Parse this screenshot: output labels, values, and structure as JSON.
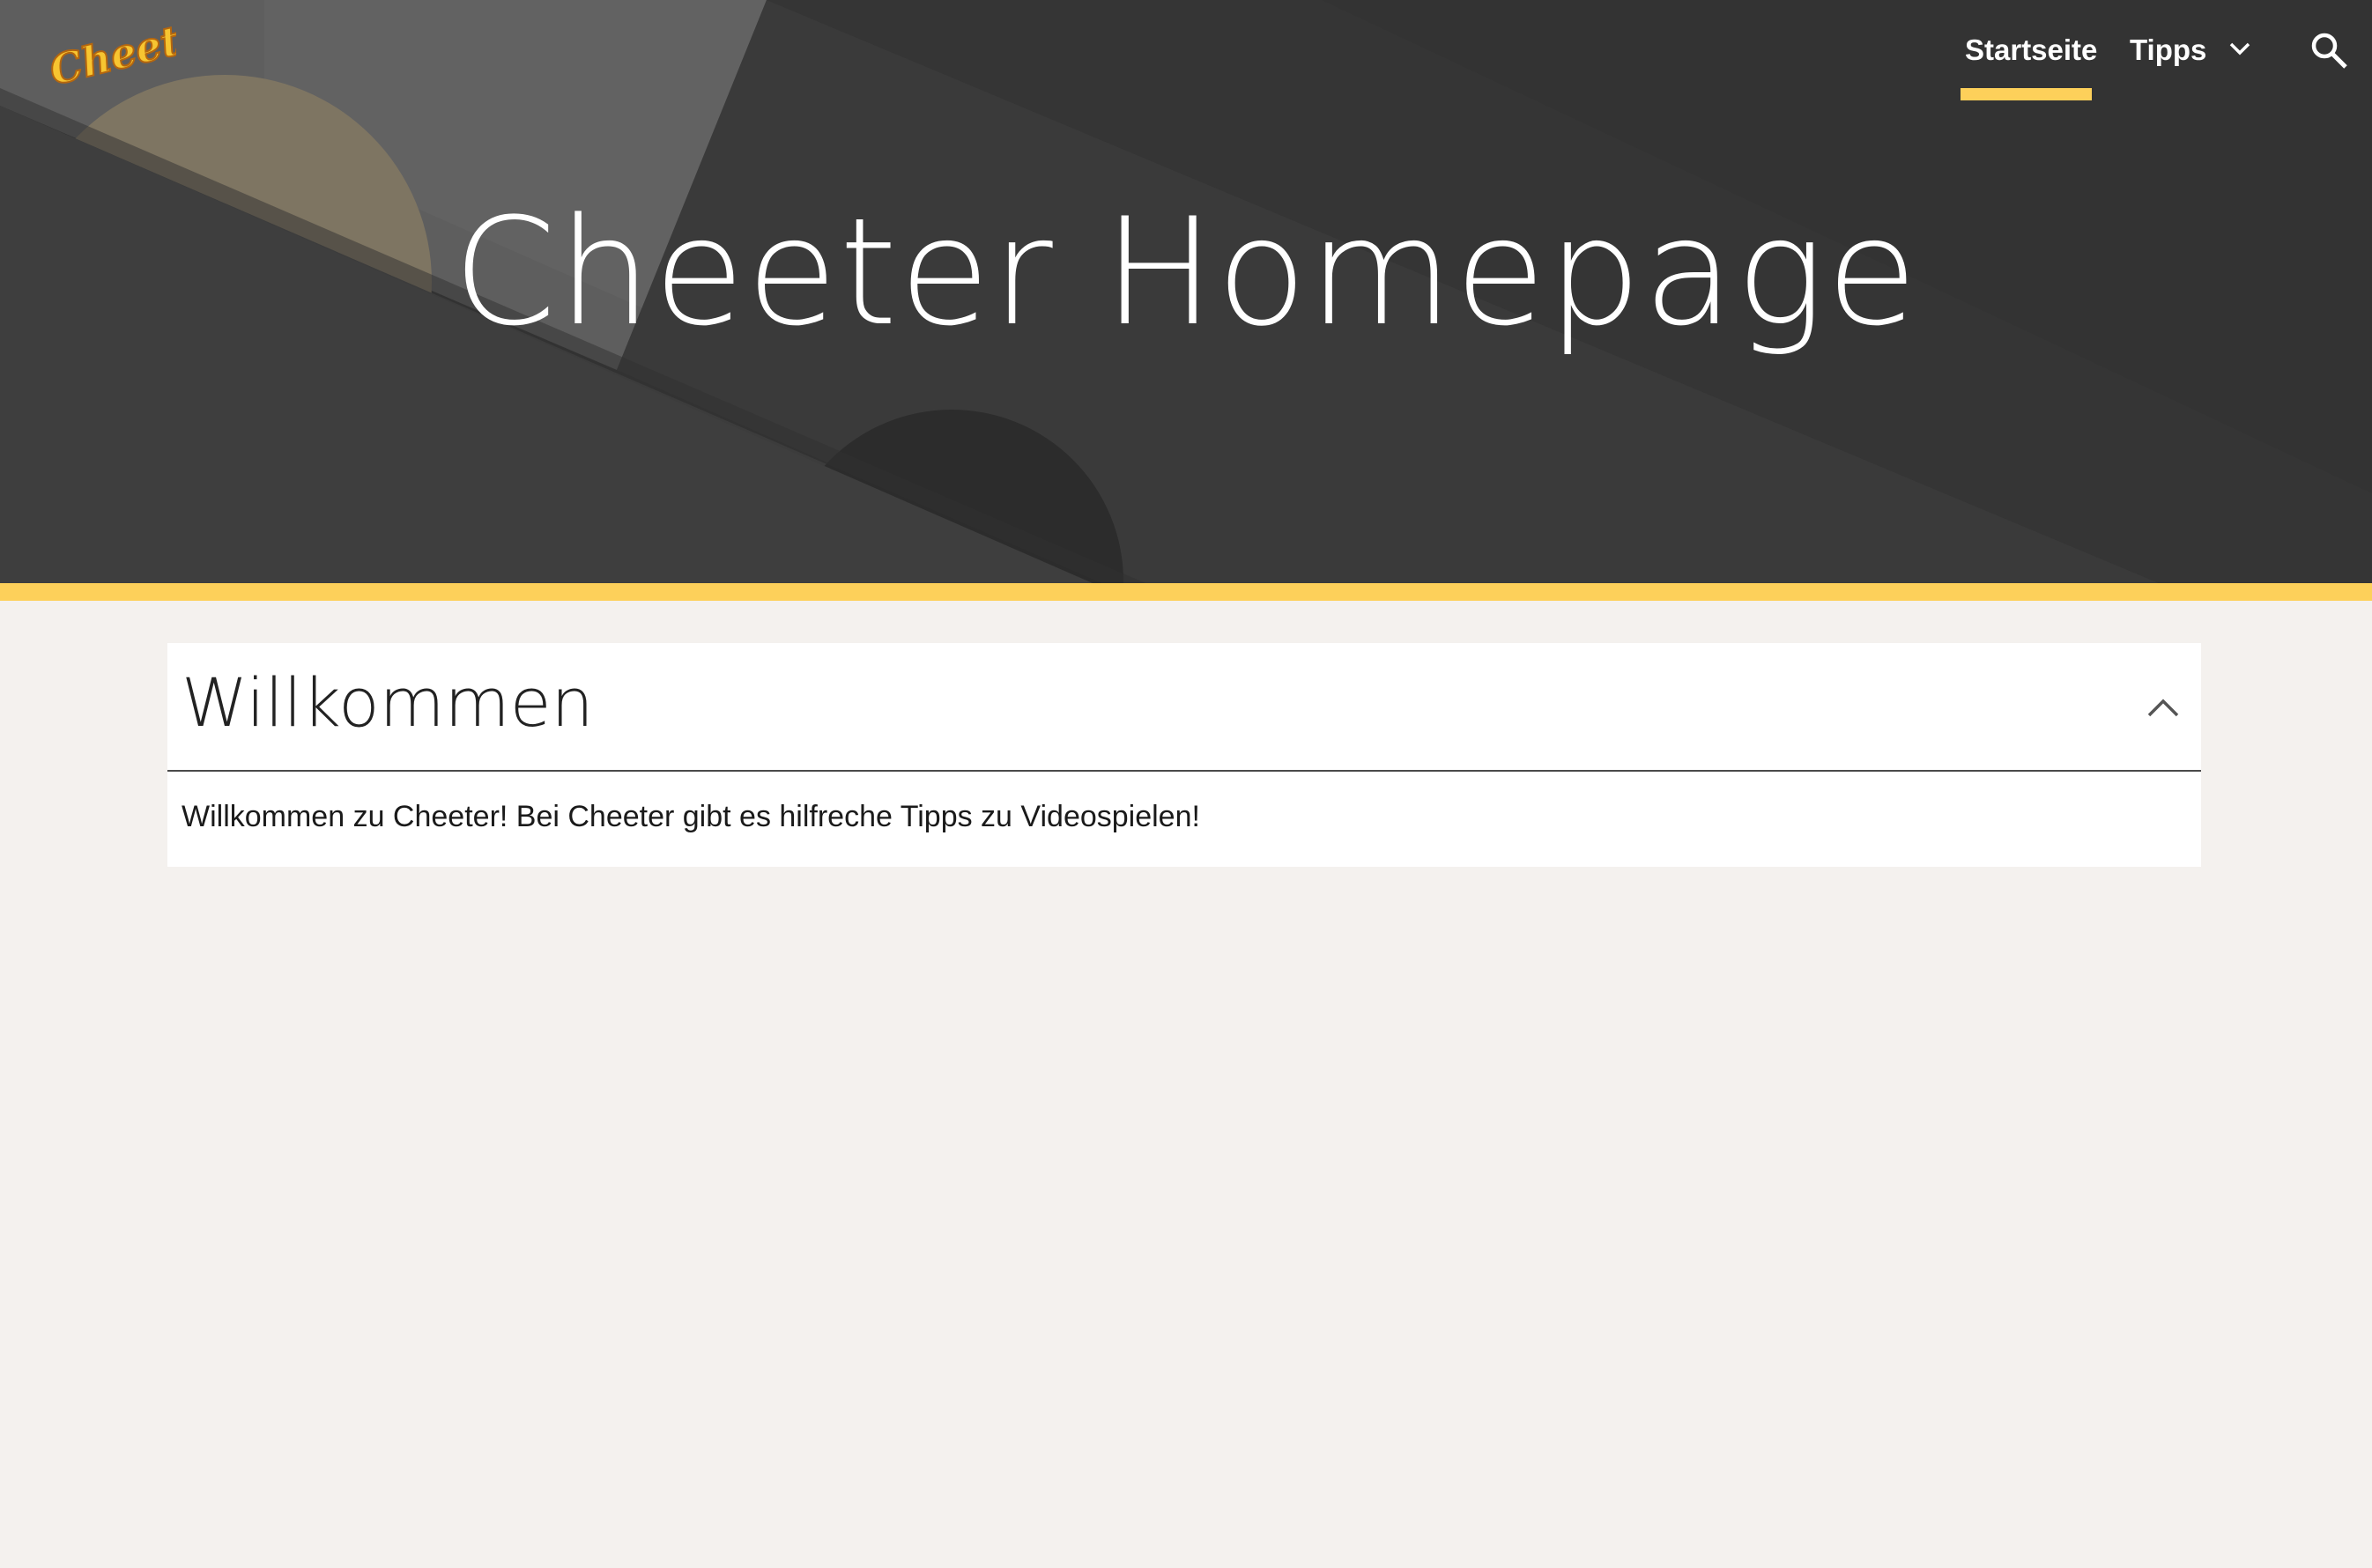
{
  "header": {
    "logo_text": "Cheeter",
    "nav": {
      "items": [
        {
          "label": "Startseite",
          "active": true
        },
        {
          "label": "Tipps",
          "has_dropdown": true
        }
      ],
      "search_icon": "search-icon",
      "dropdown_icon": "chevron-down-icon"
    }
  },
  "hero": {
    "title": "Cheeter Homepage"
  },
  "section": {
    "title": "Willkommen",
    "collapse_icon": "chevron-up-icon",
    "body": "Willkommen zu Cheeter! Bei Cheeter gibt es hilfreche Tipps zu Videospielen!"
  },
  "colors": {
    "accent": "#fdd05a",
    "hero_background": "#343434",
    "page_background": "#f4f1ee",
    "card_background": "#ffffff"
  }
}
